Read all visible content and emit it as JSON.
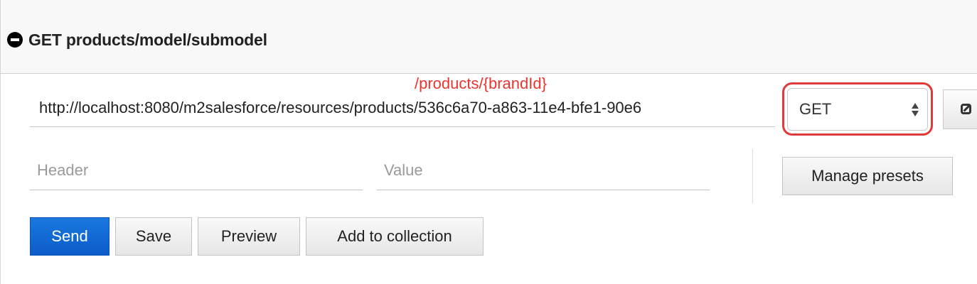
{
  "section": {
    "title": "GET products/model/submodel",
    "collapse_icon": "minus-circle-icon"
  },
  "request": {
    "url": "http://localhost:8080/m2salesforce/resources/products/536c6a70-a863-11e4-bfe1-90e6",
    "annotation": "/products/{brandId}",
    "method": {
      "selected": "GET",
      "icon": "updown-arrow-icon"
    },
    "edit_icon": "edit-icon"
  },
  "headers": {
    "header_placeholder": "Header",
    "value_placeholder": "Value",
    "manage_presets_label": "Manage presets"
  },
  "actions": {
    "send_label": "Send",
    "save_label": "Save",
    "preview_label": "Preview",
    "add_to_collection_label": "Add to collection"
  },
  "colors": {
    "annotation": "#e8352f",
    "highlight": "#e03a3a",
    "send_button": "#1a78e0"
  }
}
